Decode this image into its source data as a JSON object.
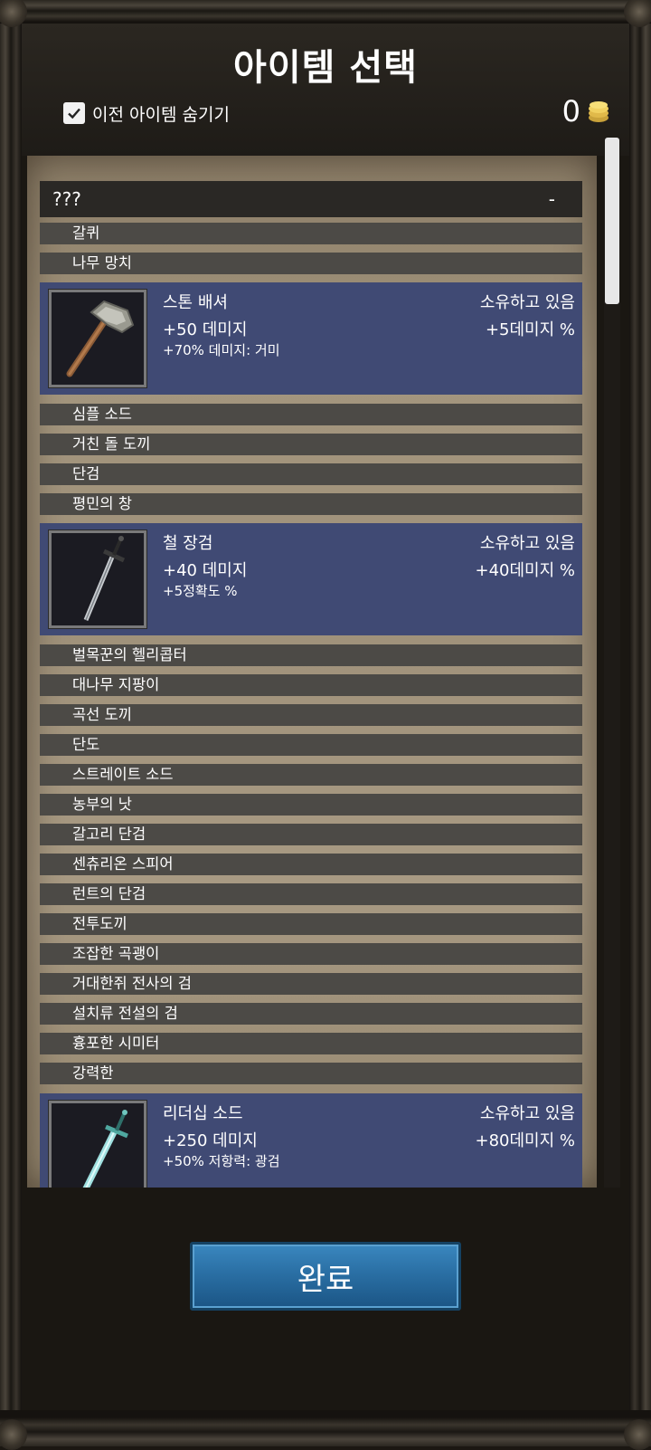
{
  "header": {
    "title": "아이템 선택",
    "hide_previous_label": "이전 아이템 숨기기",
    "hide_previous_checked": true,
    "gold_count": "0"
  },
  "list": {
    "unknown_row": {
      "label": "???",
      "value": "-"
    },
    "items_a": [
      "갈퀴",
      "나무 망치"
    ],
    "card_stone": {
      "name": "스톤 배셔",
      "owned": "소유하고 있음",
      "stat": "+50 데미지",
      "bonus": "+5데미지 %",
      "extra": "+70% 데미지: 거미"
    },
    "items_b": [
      "심플 소드",
      "거친 돌 도끼",
      "단검",
      "평민의 창"
    ],
    "card_iron": {
      "name": "철 장검",
      "owned": "소유하고 있음",
      "stat": "+40 데미지",
      "bonus": "+40데미지 %",
      "extra": "+5정확도 %"
    },
    "items_c": [
      "벌목꾼의 헬리콥터",
      "대나무 지팡이",
      "곡선 도끼",
      "단도",
      "스트레이트 소드",
      "농부의 낫",
      "갈고리 단검",
      "센츄리온 스피어",
      "런트의 단검",
      "전투도끼",
      "조잡한 곡괭이",
      "거대한쥐 전사의 검",
      "설치류 전설의 검",
      "흉포한 시미터",
      "강력한"
    ],
    "card_leader": {
      "name": "리더십 소드",
      "owned": "소유하고 있음",
      "stat": "+250 데미지",
      "bonus": "+80데미지 %",
      "extra": "+50% 저항력: 광검"
    }
  },
  "footer": {
    "done_label": "완료"
  },
  "colors": {
    "card_bg": "#404a74",
    "row_bg": "#4c4a46",
    "button": "#2a6fa4"
  }
}
